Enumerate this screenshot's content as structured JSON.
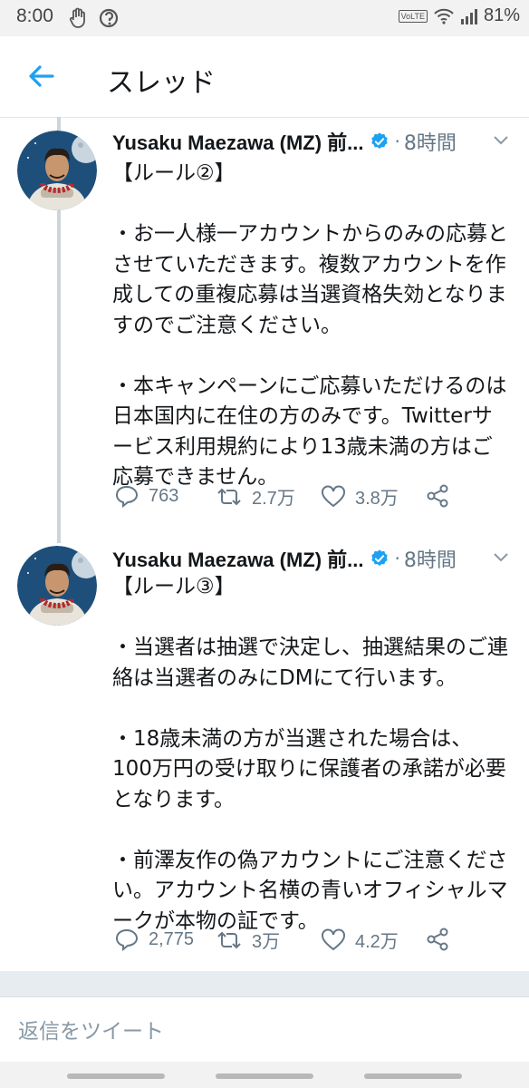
{
  "status_bar": {
    "time": "8:00",
    "network_badge": "VoLTE",
    "battery": "81%",
    "icons": [
      "hand-notification-icon",
      "sync-notification-icon",
      "volte-icon",
      "wifi-icon",
      "signal-icon",
      "battery-icon"
    ]
  },
  "header": {
    "back_icon": "back-arrow-icon",
    "title": "スレッド"
  },
  "colors": {
    "accent": "#1da1f2",
    "text": "#14171a",
    "secondary": "#657786",
    "divider": "#e1e8ed"
  },
  "tweets": [
    {
      "author": "Yusaku Maezawa (MZ) 前...",
      "verified": true,
      "dot": "·",
      "time": "8時間",
      "text": "【ルール②】\n\n・お一人様一アカウントからのみの応募とさせていただきます。複数アカウントを作成しての重複応募は当選資格失効となりますのでご注意ください。\n\n・本キャンペーンにご応募いただけるのは日本国内に在住の方のみです。Twitterサービス利用規約により13歳未満の方はご応募できません。",
      "replies": "763",
      "retweets": "2.7万",
      "likes": "3.8万"
    },
    {
      "author": "Yusaku Maezawa (MZ) 前...",
      "verified": true,
      "dot": "·",
      "time": "8時間",
      "text": "【ルール③】\n\n・当選者は抽選で決定し、抽選結果のご連絡は当選者のみにDMにて行います。\n\n・18歳未満の方が当選された場合は、100万円の受け取りに保護者の承諾が必要となります。\n\n・前澤友作の偽アカウントにご注意ください。アカウント名横の青いオフィシャルマークが本物の証です。",
      "replies": "2,775",
      "retweets": "3万",
      "likes": "4.2万"
    }
  ],
  "reply_box": {
    "placeholder": "返信をツイート"
  }
}
